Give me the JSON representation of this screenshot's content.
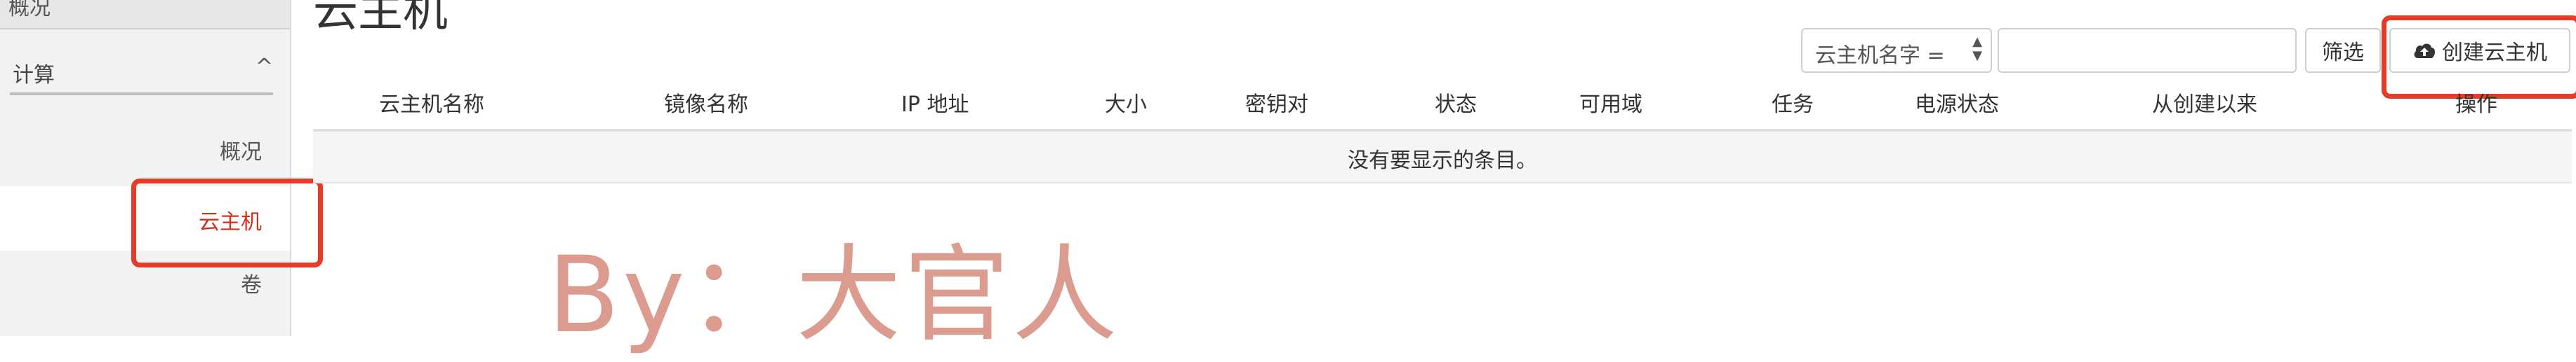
{
  "page": {
    "title": "云主机"
  },
  "sidebar": {
    "top_label": "概况",
    "section": {
      "label": "计算",
      "caret": "^"
    },
    "items": [
      {
        "label": "概况"
      },
      {
        "label": "云主机"
      },
      {
        "label": "卷"
      }
    ]
  },
  "toolbar": {
    "filter_field": {
      "selected": "云主机名字 ="
    },
    "filter_input": {
      "value": "",
      "placeholder": ""
    },
    "filter_button": "筛选",
    "create_button": "创建云主机"
  },
  "table": {
    "columns": [
      "云主机名称",
      "镜像名称",
      "IP 地址",
      "大小",
      "密钥对",
      "状态",
      "可用域",
      "任务",
      "电源状态",
      "从创建以来",
      "操作"
    ],
    "empty_message": "没有要显示的条目。"
  },
  "watermark": "By：大官人",
  "colors": {
    "highlight": "#e63b26",
    "active_item": "#d0301f",
    "watermark": "#d58a7c"
  },
  "icons": {
    "create": "cloud-upload-icon",
    "section_toggle": "chevron-up-icon",
    "select": "sort-arrows-icon"
  }
}
